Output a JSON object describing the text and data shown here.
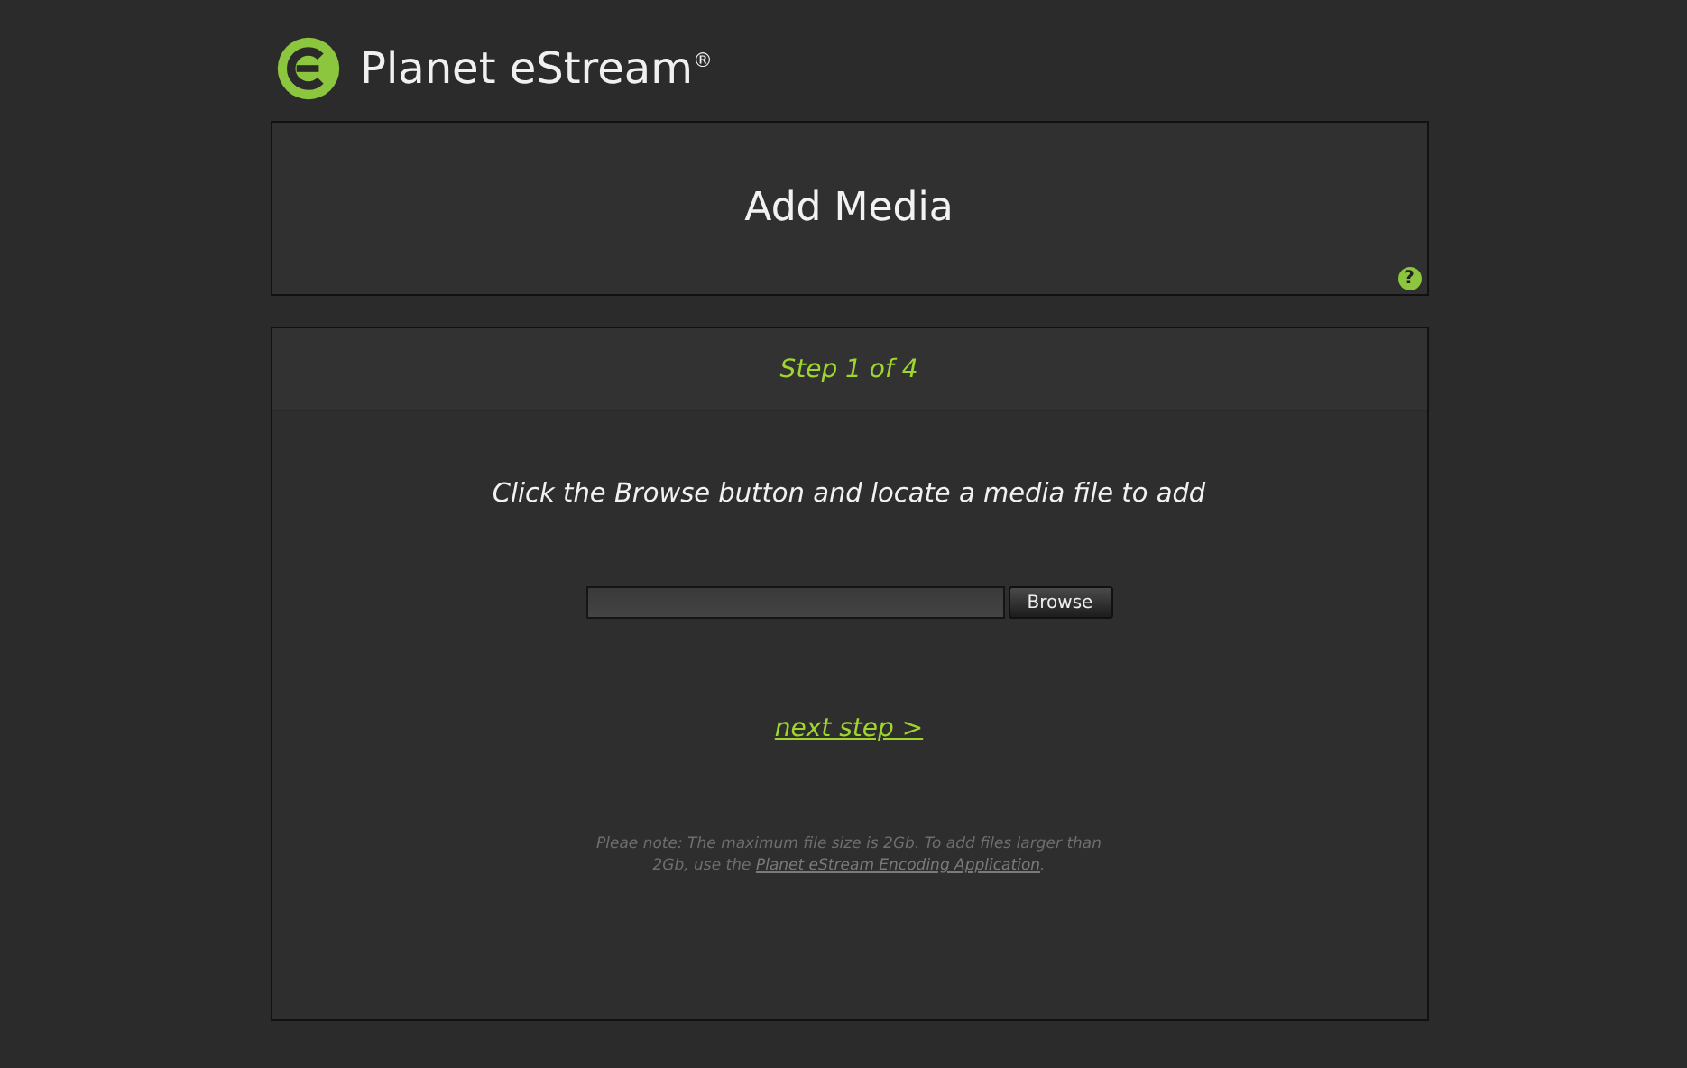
{
  "brand": {
    "name": "Planet eStream",
    "mark": "®"
  },
  "title_panel": {
    "title": "Add Media",
    "help": "?"
  },
  "step_panel": {
    "step": "Step 1 of 4",
    "instruction": "Click the Browse button and locate a media file to add",
    "browse_button": "Browse",
    "next_link": "next step >",
    "note": {
      "before": "Pleae note: The maximum file size is 2Gb. To add files larger than 2Gb, use the ",
      "link": "Planet eStream Encoding Application",
      "after": "."
    }
  }
}
